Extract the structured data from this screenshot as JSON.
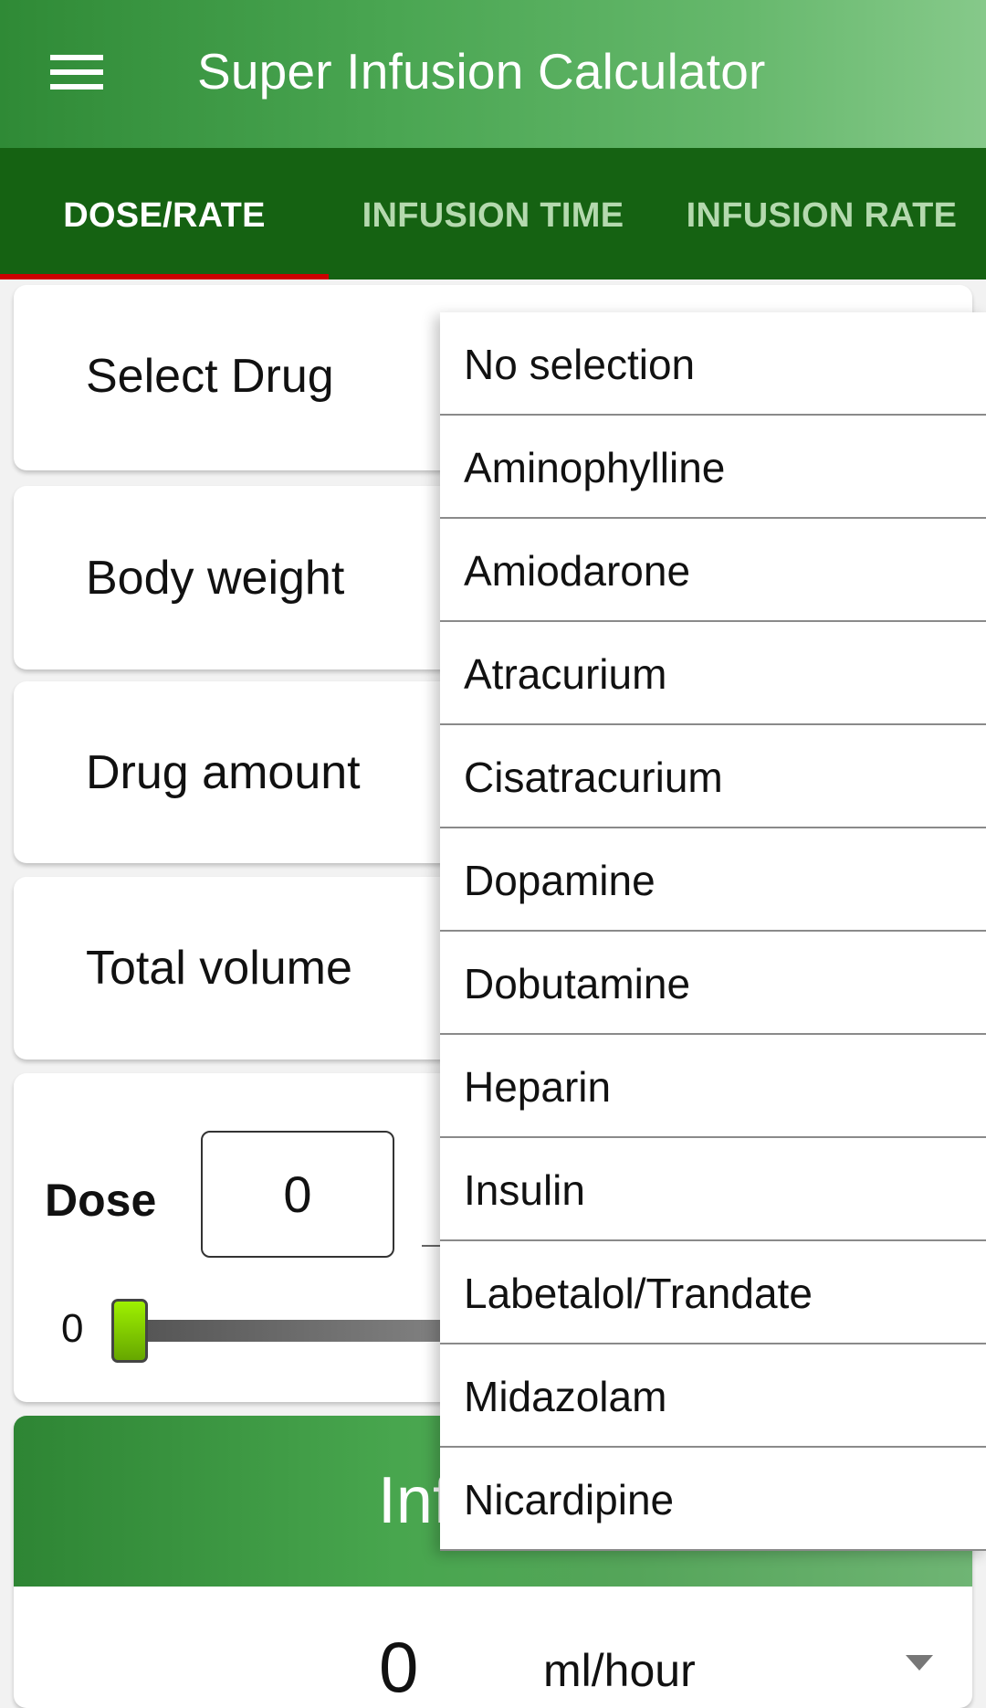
{
  "app": {
    "title": "Super Infusion Calculator",
    "menu_icon": "hamburger-menu-icon"
  },
  "tabs": [
    {
      "label": "DOSE/RATE",
      "active": true
    },
    {
      "label": "INFUSION TIME",
      "active": false
    },
    {
      "label": "INFUSION RATE",
      "active": false
    }
  ],
  "colors": {
    "toolbar": "#4aa652",
    "tab_bar": "#156212",
    "tab_indicator": "#cc0000",
    "slider_thumb": "#8fd400"
  },
  "form": {
    "select_drug_label": "Select Drug",
    "body_weight_label": "Body weight",
    "drug_amount_label": "Drug amount",
    "total_volume_label": "Total volume",
    "dose_label": "Dose",
    "dose_value": "0",
    "slider_min_label": "0",
    "slider_value": 0
  },
  "result": {
    "title": "Infusion",
    "value": "0",
    "unit": "ml/hour"
  },
  "dropdown": {
    "options": [
      "No selection",
      "Aminophylline",
      "Amiodarone",
      "Atracurium",
      "Cisatracurium",
      "Dopamine",
      "Dobutamine",
      "Heparin",
      "Insulin",
      "Labetalol/Trandate",
      "Midazolam",
      "Nicardipine"
    ]
  }
}
